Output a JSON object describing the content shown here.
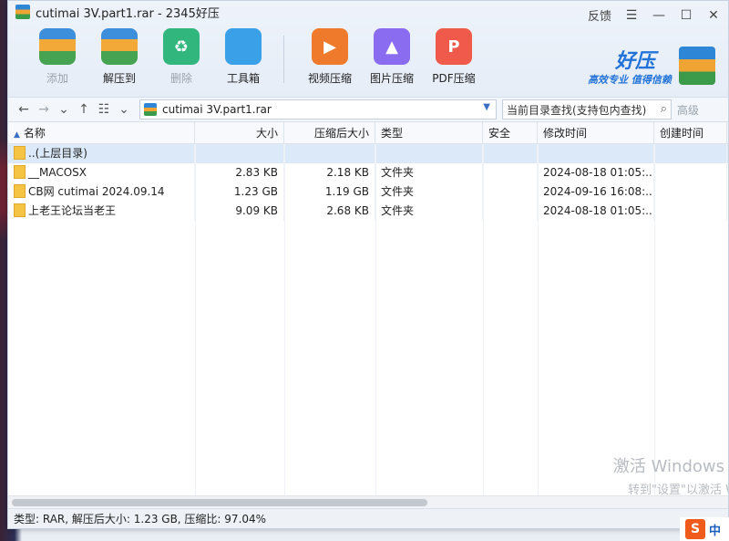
{
  "window": {
    "title": "cutimai  3V.part1.rar - 2345好压",
    "feedback_label": "反馈",
    "menu_icon": "hamburger-icon",
    "minimize_icon": "minimize-icon",
    "maximize_icon": "maximize-icon",
    "close_icon": "close-icon"
  },
  "toolbar": {
    "items": [
      {
        "label": "添加",
        "icon": "add-archive-icon",
        "disabled": true
      },
      {
        "label": "解压到",
        "icon": "extract-icon",
        "disabled": false
      },
      {
        "label": "删除",
        "icon": "recycle-delete-icon",
        "disabled": true
      },
      {
        "label": "工具箱",
        "icon": "toolbox-icon",
        "disabled": false
      },
      {
        "label": "视频压缩",
        "icon": "video-compress-icon",
        "disabled": false
      },
      {
        "label": "图片压缩",
        "icon": "image-compress-icon",
        "disabled": false
      },
      {
        "label": "PDF压缩",
        "icon": "pdf-compress-icon",
        "disabled": false
      }
    ]
  },
  "brand": {
    "name": "好压",
    "slogan": "高效专业  值得信赖",
    "color": "#2273d8"
  },
  "address": {
    "path": "cutimai  3V.part1.rar",
    "search_placeholder": "当前目录查找(支持包内查找)",
    "advanced_label": "高级"
  },
  "table": {
    "columns": [
      "名称",
      "大小",
      "压缩后大小",
      "类型",
      "安全",
      "修改时间",
      "创建时间"
    ],
    "rows": [
      {
        "name": "..(上层目录)",
        "size": "",
        "csize": "",
        "type": "",
        "security": "",
        "mtime": "",
        "ctime": "",
        "selected": true
      },
      {
        "name": "__MACOSX",
        "size": "2.83 KB",
        "csize": "2.18 KB",
        "type": "文件夹",
        "security": "",
        "mtime": "2024-08-18 01:05:...",
        "ctime": "",
        "selected": false
      },
      {
        "name": "CB网 cutimai 2024.09.14",
        "size": "1.23 GB",
        "csize": "1.19 GB",
        "type": "文件夹",
        "security": "",
        "mtime": "2024-09-16 16:08:...",
        "ctime": "",
        "selected": false
      },
      {
        "name": "上老王论坛当老王",
        "size": "9.09 KB",
        "csize": "2.68 KB",
        "type": "文件夹",
        "security": "",
        "mtime": "2024-08-18 01:05:...",
        "ctime": "",
        "selected": false
      }
    ]
  },
  "watermark": {
    "line1": "激活 Windows",
    "line2": "转到\"设置\"以激活 W"
  },
  "status": {
    "text": "类型: RAR, 解压后大小: 1.23 GB, 压缩比: 97.04%"
  },
  "ime": {
    "icon": "sogou-s-icon",
    "label": "中"
  }
}
